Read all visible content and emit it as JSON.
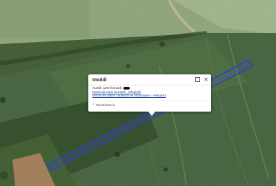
{
  "popup": {
    "title": "Imobil",
    "cad_number_label": "Număr carte funciară:",
    "cad_number_value": "",
    "link_1": "Extras de carte funciară - eRegistrii",
    "link_2": "Extras din planul cadastral pe ortofotoplan - eRegistrii",
    "zoom_label": "Transferare la"
  },
  "map": {
    "parcel_outline_color": "#2f3bd8",
    "parcel_fill": "rgba(60,70,220,0.18)"
  }
}
